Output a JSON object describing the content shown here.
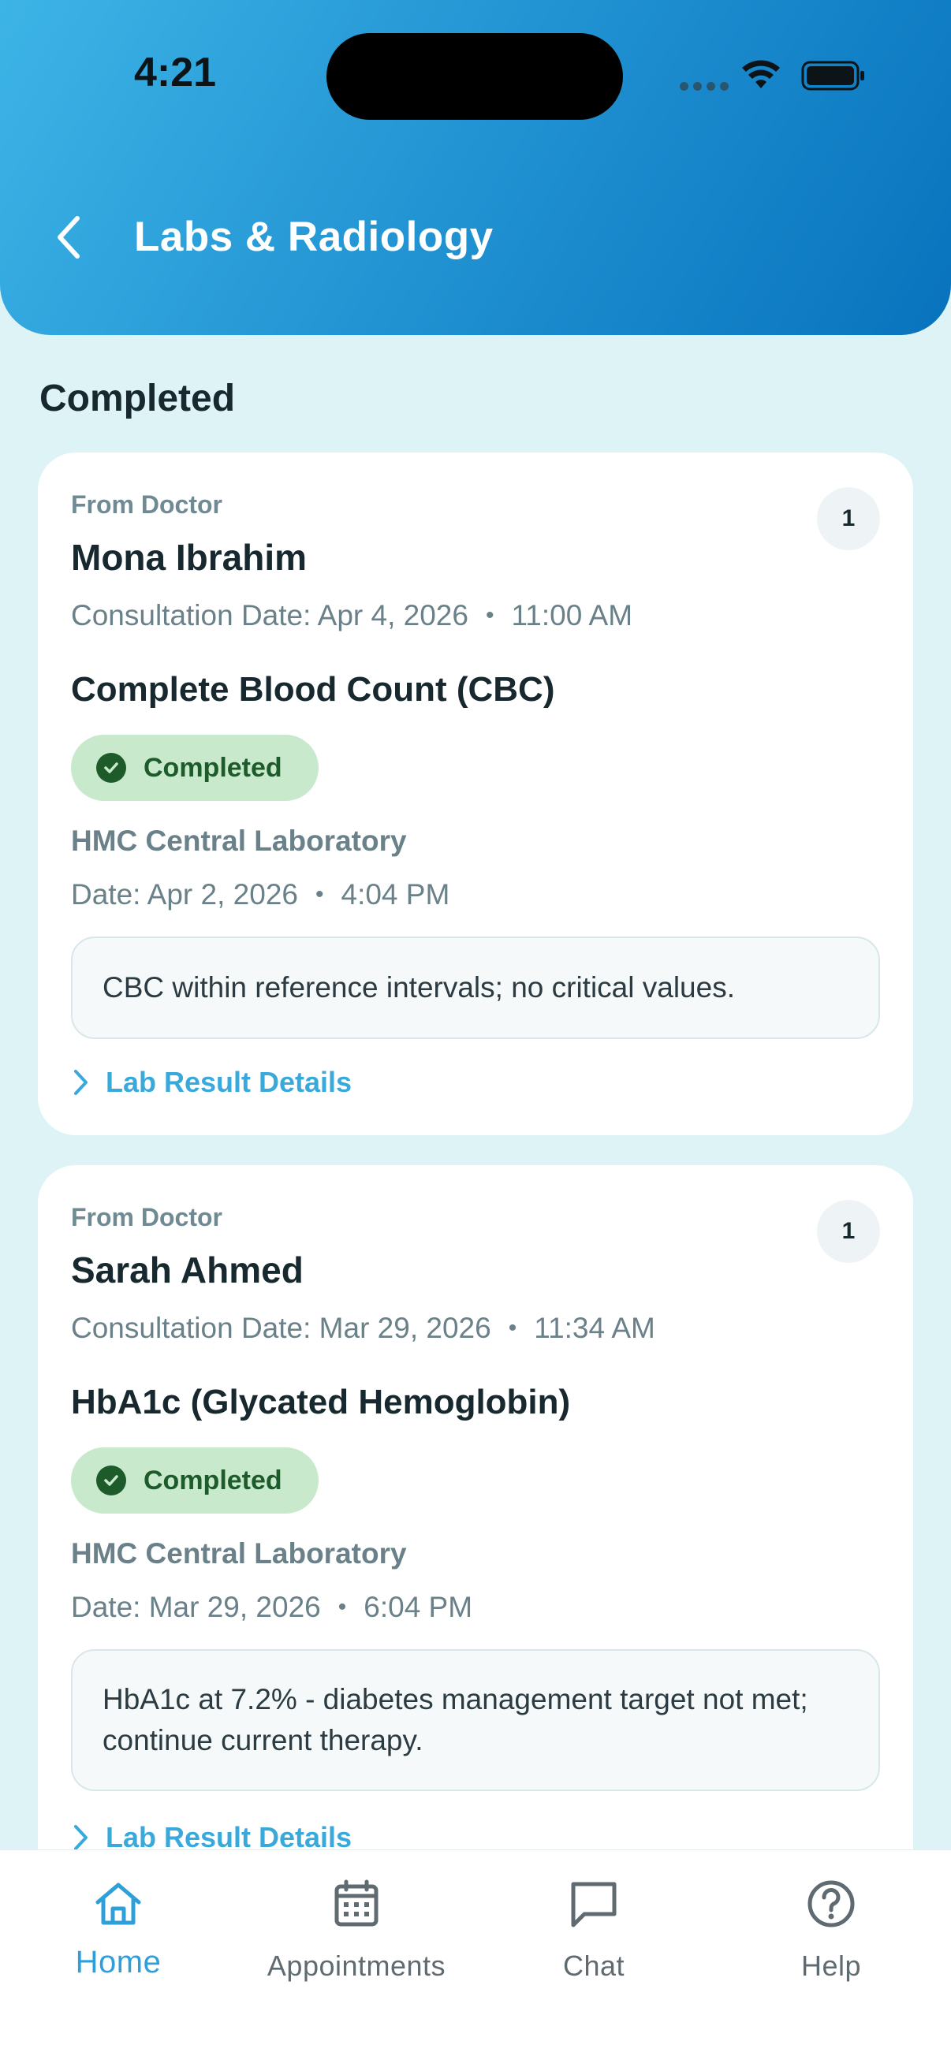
{
  "status_bar": {
    "time": "4:21"
  },
  "header": {
    "title": "Labs & Radiology"
  },
  "section": {
    "title": "Completed"
  },
  "cards": [
    {
      "from_label": "From Doctor",
      "count": "1",
      "doctor": "Mona Ibrahim",
      "consultation_label": "Consultation Date: Apr 4, 2026",
      "consultation_time": "11:00 AM",
      "test_name": "Complete Blood Count (CBC)",
      "status": "Completed",
      "lab_name": "HMC Central Laboratory",
      "date_label": "Date: Apr 2, 2026",
      "date_time": "4:04 PM",
      "note": "CBC within reference intervals; no critical values.",
      "details_link": "Lab Result Details"
    },
    {
      "from_label": "From Doctor",
      "count": "1",
      "doctor": "Sarah Ahmed",
      "consultation_label": "Consultation Date: Mar 29, 2026",
      "consultation_time": "11:34 AM",
      "test_name": "HbA1c (Glycated Hemoglobin)",
      "status": "Completed",
      "lab_name": "HMC Central Laboratory",
      "date_label": "Date: Mar 29, 2026",
      "date_time": "6:04 PM",
      "note": "HbA1c at 7.2% - diabetes management target not met; continue current therapy.",
      "details_link": "Lab Result Details"
    }
  ],
  "bottom_nav": {
    "items": [
      {
        "label": "Home",
        "icon": "home-icon",
        "active": true
      },
      {
        "label": "Appointments",
        "icon": "calendar-icon",
        "active": false
      },
      {
        "label": "Chat",
        "icon": "chat-icon",
        "active": false
      },
      {
        "label": "Help",
        "icon": "help-icon",
        "active": false
      }
    ]
  },
  "colors": {
    "header_gradient_start": "#3db4e6",
    "header_gradient_end": "#0873bd",
    "background": "#ddf3f6",
    "accent": "#2f9fda",
    "status_pill_bg": "#c9e9cc",
    "status_pill_text": "#1e5b2b"
  }
}
